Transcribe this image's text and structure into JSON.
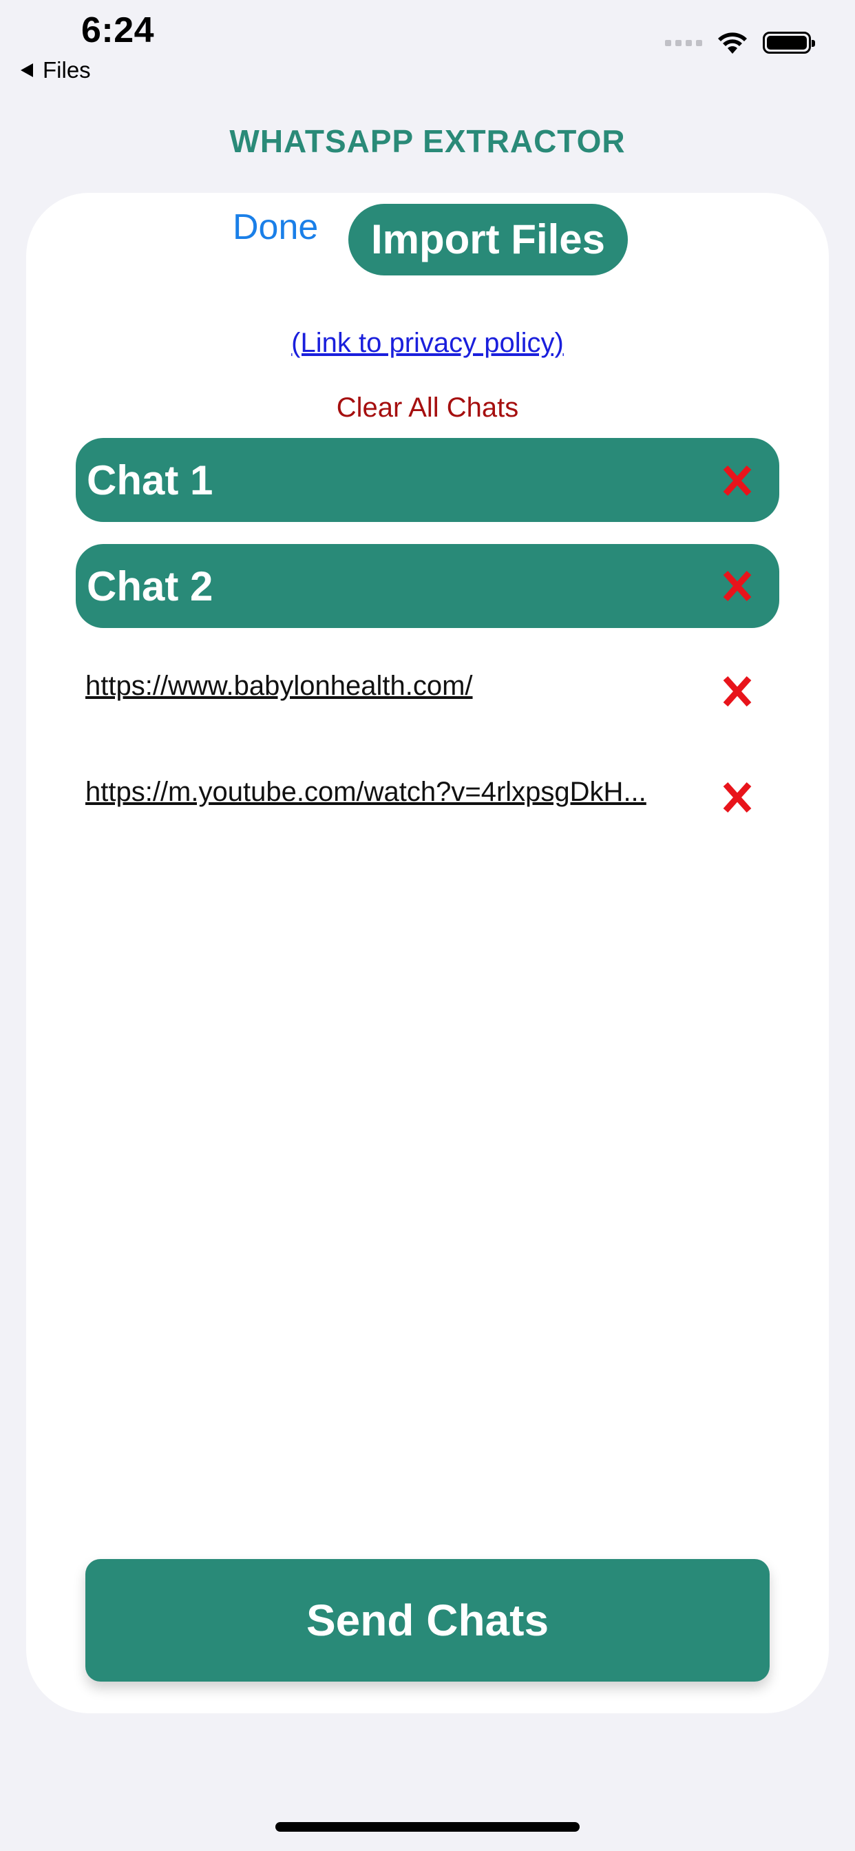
{
  "status_bar": {
    "time": "6:24",
    "back_label": "Files",
    "icons": [
      "cellular-signal-icon",
      "wifi-icon",
      "battery-icon"
    ]
  },
  "app": {
    "title": "WHATSAPP EXTRACTOR"
  },
  "toolbar": {
    "done_label": "Done",
    "import_label": "Import Files"
  },
  "privacy_link": "(Link to privacy policy)",
  "clear_all_label": "Clear All Chats",
  "chats": [
    {
      "label": "Chat 1"
    },
    {
      "label": "Chat 2"
    }
  ],
  "links": [
    {
      "url": "https://www.babylonhealth.com/"
    },
    {
      "url": "https://m.youtube.com/watch?v=4rlxpsgDkH..."
    }
  ],
  "send_label": "Send Chats",
  "colors": {
    "accent": "#298a78",
    "title": "#2a8a78",
    "done": "#1a7fe8",
    "link": "#1a1fdc",
    "clear": "#a50f0f",
    "delete": "#e8141b",
    "background": "#f2f2f7",
    "card": "#ffffff"
  }
}
